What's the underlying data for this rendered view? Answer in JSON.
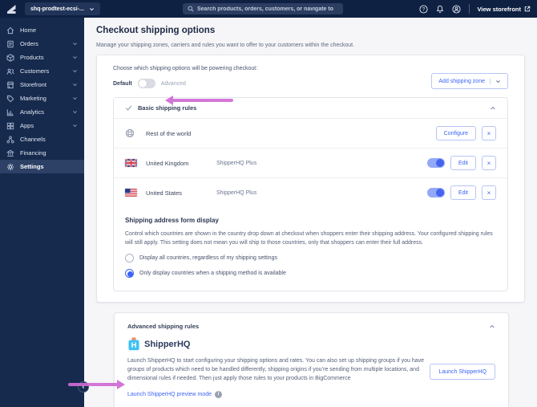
{
  "topbar": {
    "store_name": "shq-prodtest-ecsi-...",
    "search_placeholder": "Search products, orders, customers, or navigate to",
    "view_storefront_label": "View storefront"
  },
  "sidebar": {
    "items": [
      {
        "label": "Home",
        "expandable": false
      },
      {
        "label": "Orders",
        "expandable": true
      },
      {
        "label": "Products",
        "expandable": true
      },
      {
        "label": "Customers",
        "expandable": true
      },
      {
        "label": "Storefront",
        "expandable": true
      },
      {
        "label": "Marketing",
        "expandable": true
      },
      {
        "label": "Analytics",
        "expandable": true
      },
      {
        "label": "Apps",
        "expandable": true
      },
      {
        "label": "Channels",
        "expandable": false
      },
      {
        "label": "Financing",
        "expandable": false
      },
      {
        "label": "Settings",
        "expandable": false,
        "active": true
      }
    ]
  },
  "page": {
    "title": "Checkout shipping options",
    "subtitle": "Manage your shipping zones, carriers and rules you want to offer to your customers within the checkout."
  },
  "options_card": {
    "choose_label": "Choose which shipping options will be powering checkout:",
    "toggle_left": "Default",
    "toggle_right": "Advanced",
    "toggle_state": "Default",
    "add_zone_button": "Add shipping zone"
  },
  "basic_rules": {
    "header": "Basic shipping rules",
    "rows": [
      {
        "name": "Rest of the world",
        "provider": "",
        "action": "Configure",
        "remove": "×",
        "toggle": null
      },
      {
        "name": "United Kingdom",
        "provider": "ShipperHQ Plus",
        "action": "Edit",
        "remove": "×",
        "toggle": "on"
      },
      {
        "name": "United States",
        "provider": "ShipperHQ Plus",
        "action": "Edit",
        "remove": "×",
        "toggle": "on"
      }
    ]
  },
  "address_form": {
    "heading": "Shipping address form display",
    "description": "Control which countries are shown in the country drop down at checkout when shoppers enter their shipping address. Your configured shipping rules will still apply. This setting does not mean you will ship to those countries, only that shoppers can enter their full address.",
    "options": [
      {
        "label": "Display all countries, regardless of my shipping settings",
        "selected": false
      },
      {
        "label": "Only display countries when a shipping method is available",
        "selected": true
      }
    ]
  },
  "advanced_rules": {
    "header": "Advanced shipping rules",
    "logo_text": "ShipperHQ",
    "description": "Launch ShipperHQ to start configuring your shipping options and rates. You can also set up shipping groups if you have groups of products which need to be handled differently, shipping origins if you’re sending from multiple locations, and dimensional rules if needed. Then just apply those rules to your products in BigCommerce",
    "launch_button": "Launch ShipperHQ",
    "preview_link": "Launch ShipperHQ preview mode",
    "info_glyph": "i"
  },
  "colors": {
    "accent_blue": "#3c64f4",
    "topbar_bg": "#0f2143",
    "sidebar_bg": "#152a4d",
    "annotation_arrow": "#cf6bd4",
    "page_bg": "#f6f6f8",
    "toggle_on": "#4565f0"
  }
}
